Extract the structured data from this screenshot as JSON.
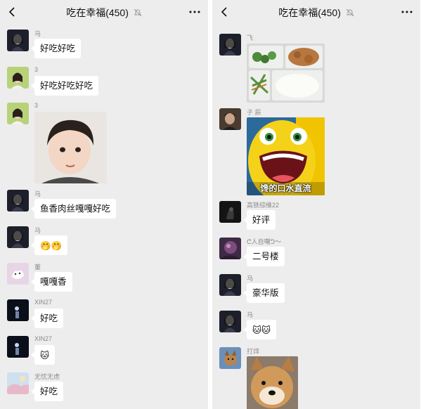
{
  "header": {
    "title": "吃在幸福(450)"
  },
  "left": {
    "messages": [
      {
        "sender": "马",
        "text": "好吃好吃"
      },
      {
        "sender": "3",
        "text": "好吃好吃好吃"
      },
      {
        "sender": "3"
      },
      {
        "sender": "马",
        "text": "鱼香肉丝嘎嘎好吃"
      },
      {
        "sender": "马",
        "emoji": "🤭🤭"
      },
      {
        "sender": "董",
        "text": "嘎嘎香"
      },
      {
        "sender": "XIN27",
        "text": "好吃"
      },
      {
        "sender": "XIN27",
        "emoji": "🐱"
      },
      {
        "sender": "无忧无虑",
        "text": "好吃"
      }
    ]
  },
  "right": {
    "messages": [
      {
        "sender": "飞"
      },
      {
        "sender": "子 辰",
        "sticker_caption": "馋的口水直流"
      },
      {
        "sender": "高铁综维22",
        "text": "好评"
      },
      {
        "sender": "ᕦ人自嘲ᕤ〜",
        "text": "二号楼"
      },
      {
        "sender": "马",
        "text": "豪华版"
      },
      {
        "sender": "马",
        "emoji": "🐱🐱"
      },
      {
        "sender": "打烊"
      }
    ]
  },
  "icons": {
    "back": "chevron-left-icon",
    "mute": "bell-off-icon",
    "more": "more-dots-icon"
  },
  "colors": {
    "background": "#ededed",
    "bubble": "#ffffff",
    "name": "#8a8a8a"
  }
}
